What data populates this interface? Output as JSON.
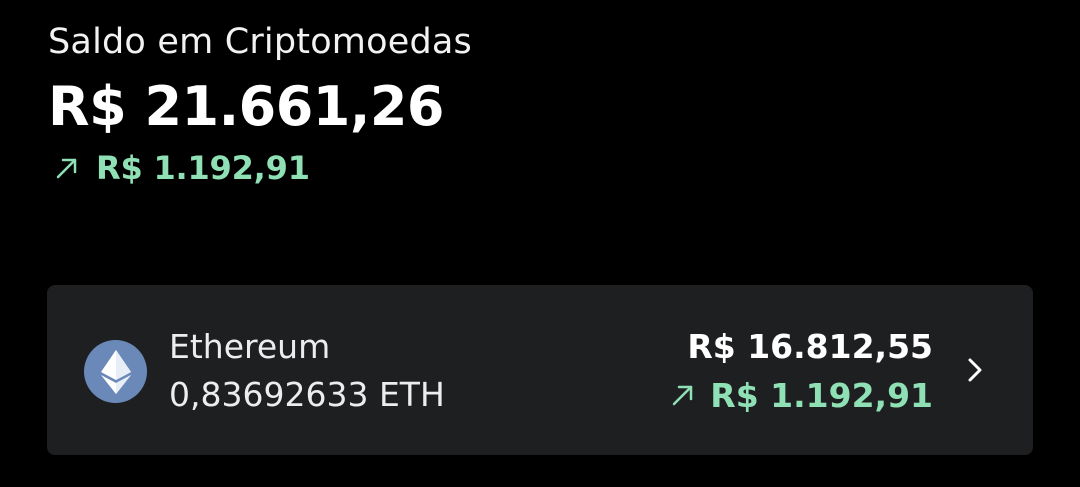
{
  "header": {
    "title": "Saldo em Criptomoedas",
    "balance": "R$ 21.661,26",
    "change": "R$ 1.192,91",
    "change_icon": "arrow-up-right-icon"
  },
  "colors": {
    "background": "#000000",
    "card": "#1e1f21",
    "positive": "#8fe0b4",
    "eth_logo": "#6b89b8"
  },
  "assets": [
    {
      "name": "Ethereum",
      "amount": "0,83692633 ETH",
      "value": "R$ 16.812,55",
      "change": "R$ 1.192,91",
      "icon": "ethereum-icon",
      "change_icon": "arrow-up-right-icon",
      "action_icon": "chevron-right-icon"
    }
  ]
}
